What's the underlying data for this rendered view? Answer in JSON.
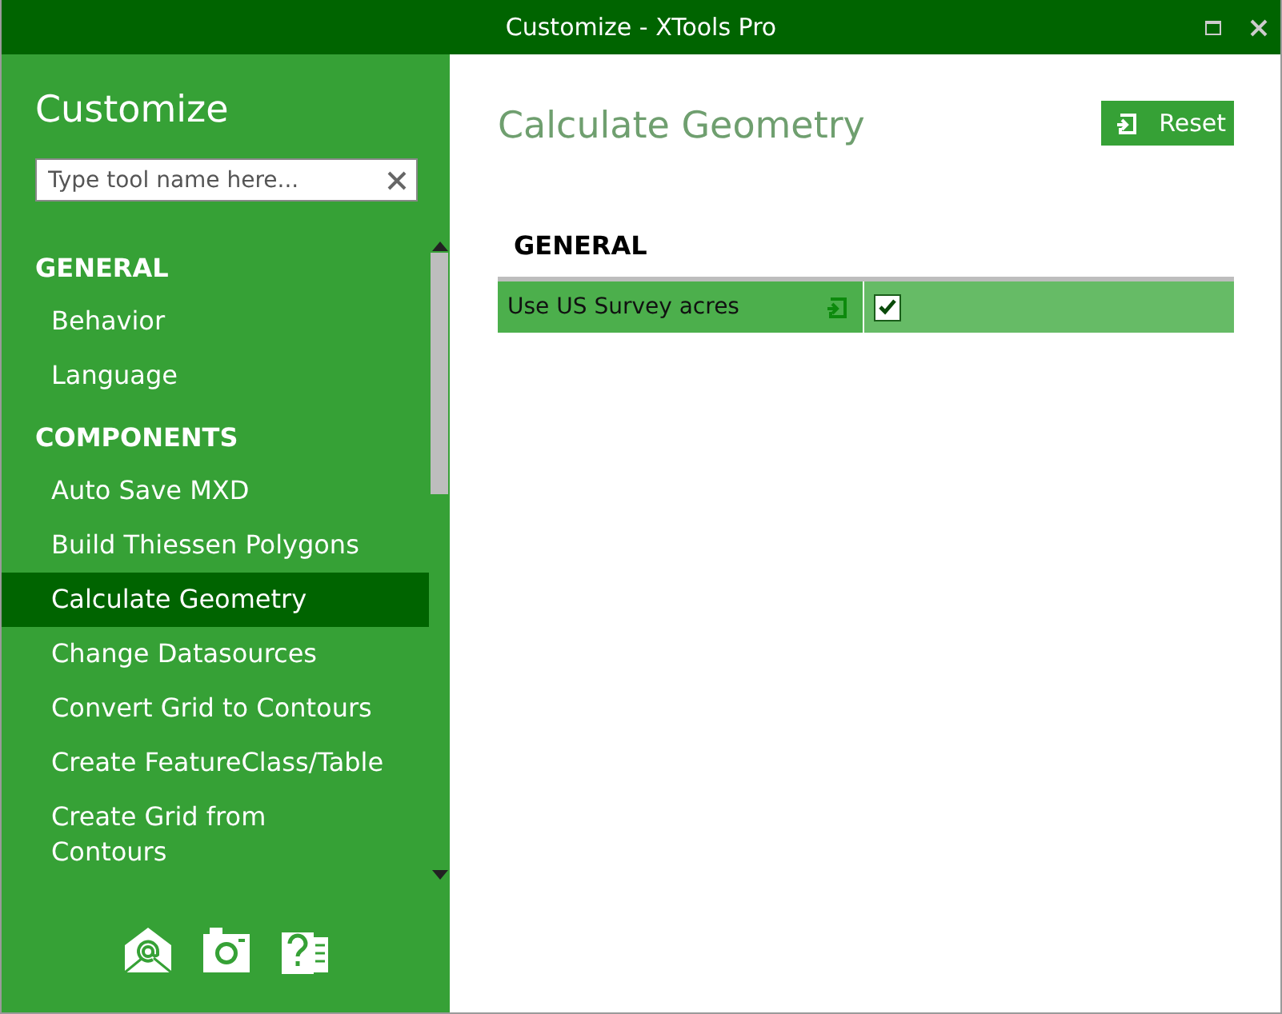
{
  "window": {
    "title": "Customize - XTools Pro"
  },
  "sidebar": {
    "heading": "Customize",
    "search": {
      "placeholder": "Type tool name here..."
    },
    "sections": [
      {
        "title": "GENERAL",
        "items": [
          {
            "label": "Behavior",
            "selected": false
          },
          {
            "label": "Language",
            "selected": false
          }
        ]
      },
      {
        "title": "COMPONENTS",
        "items": [
          {
            "label": "Auto Save MXD",
            "selected": false
          },
          {
            "label": "Build Thiessen Polygons",
            "selected": false
          },
          {
            "label": "Calculate Geometry",
            "selected": true
          },
          {
            "label": "Change Datasources",
            "selected": false
          },
          {
            "label": "Convert Grid to Contours",
            "selected": false
          },
          {
            "label": "Create FeatureClass/Table",
            "selected": false
          },
          {
            "label": "Create Grid from\nContours",
            "selected": false
          }
        ]
      }
    ]
  },
  "content": {
    "title": "Calculate Geometry",
    "reset_button": "Reset",
    "section": "GENERAL",
    "settings": [
      {
        "label": "Use US Survey acres",
        "kind": "checkbox",
        "checked": true
      }
    ]
  }
}
